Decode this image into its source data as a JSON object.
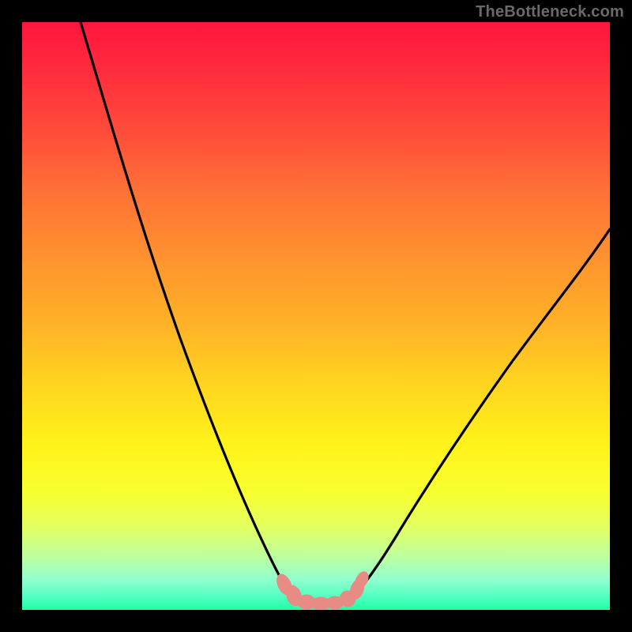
{
  "watermark": {
    "text": "TheBottleneck.com"
  },
  "colors": {
    "frame": "#000000",
    "curve_stroke": "#000000",
    "bump_fill": "#e88b84",
    "bump_stroke": "#e88b84",
    "gradient_stops": [
      "#ff153f",
      "#ff2b3d",
      "#ff4a3a",
      "#ff6e36",
      "#ff922f",
      "#ffb427",
      "#ffd61f",
      "#fff31a",
      "#f7ff2e",
      "#e2ff62",
      "#bdffa0",
      "#8effcf",
      "#4cffc2",
      "#1effa2"
    ]
  },
  "chart_data": {
    "type": "line",
    "title": "",
    "xlabel": "",
    "ylabel": "",
    "xlim": [
      0,
      100
    ],
    "ylim": [
      0,
      100
    ],
    "grid": false,
    "legend": false,
    "annotations": [
      "TheBottleneck.com"
    ],
    "series": [
      {
        "name": "left-branch",
        "x": [
          10,
          14,
          18,
          22,
          26,
          30,
          34,
          38,
          41,
          43,
          45
        ],
        "y": [
          100,
          90,
          80,
          70,
          60,
          48,
          36,
          24,
          12,
          6,
          2
        ]
      },
      {
        "name": "right-branch",
        "x": [
          55,
          58,
          62,
          66,
          72,
          78,
          85,
          92,
          100
        ],
        "y": [
          2,
          6,
          12,
          20,
          30,
          40,
          50,
          58,
          66
        ]
      }
    ],
    "bottom_markers": {
      "name": "bumps",
      "x": [
        44,
        46,
        48,
        50,
        52,
        54,
        56
      ],
      "y": [
        3,
        2,
        2,
        2,
        2,
        2,
        4
      ]
    },
    "note": "x and y are percentages of the plot area; curve is a V-shaped bottleneck profile with a cluster of small pink markers at the minimum."
  }
}
